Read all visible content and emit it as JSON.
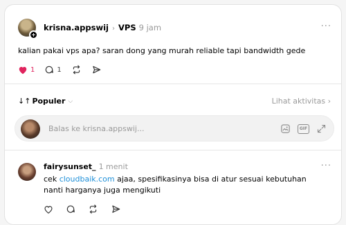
{
  "post": {
    "username": "krisna.appswij",
    "separator": "›",
    "topic": "VPS",
    "time": "9 jam",
    "more": "···",
    "text": "kalian pakai vps apa? saran dong yang murah reliable tapi bandwidth gede",
    "likes": "1",
    "liked": true,
    "replies": "1",
    "icons": [
      "heart-filled-icon",
      "comment-icon",
      "repost-icon",
      "share-icon"
    ]
  },
  "sort": {
    "icon": "↓↑",
    "label": "Populer",
    "chevron": "⌵",
    "activity_link": "Lihat aktivitas ›"
  },
  "reply": {
    "placeholder": "Balas ke krisna.appswij...",
    "icons": [
      "image-icon",
      "gif-icon",
      "expand-icon"
    ],
    "gif_label": "GIF"
  },
  "comment": {
    "username": "fairysunset_",
    "time": "1 menit",
    "more": "···",
    "text_before": "cek ",
    "link": "cloudbaik.com",
    "text_after": " ajaa, spesifikasinya bisa di atur sesuai kebutuhan nanti harganya juga mengikuti",
    "icons": [
      "heart-icon",
      "comment-icon",
      "repost-icon",
      "share-icon"
    ]
  },
  "colors": {
    "like": "#e0245e",
    "link": "#1d8fd8",
    "muted": "#999999"
  }
}
